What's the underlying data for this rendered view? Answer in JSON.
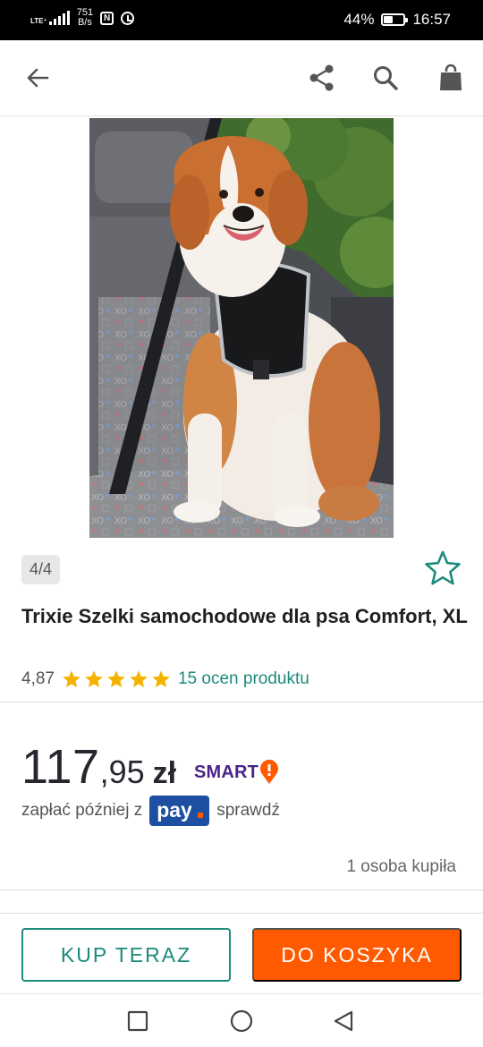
{
  "status_bar": {
    "network": "LTE⁺",
    "speed_value": "751",
    "speed_unit": "B/s",
    "nfc": "N",
    "battery": "44%",
    "battery_fill_fraction": 0.44,
    "time": "16:57"
  },
  "app_bar": {
    "icons": [
      "back-arrow-icon",
      "share-icon",
      "search-icon",
      "shopping-bag-icon"
    ]
  },
  "gallery": {
    "image_description": "dog-in-car-harness",
    "counter": "4/4"
  },
  "product": {
    "title": "Trixie Szelki samochodowe dla psa Comfort, XL",
    "rating_value": "4,87",
    "rating_stars": 5,
    "ratings_link": "15 ocen produktu"
  },
  "price": {
    "integer": "117",
    "decimal": ",95",
    "currency": "zł",
    "smart_label": "SMART"
  },
  "pay_later": {
    "prefix": "zapłać później z",
    "badge": "pay",
    "suffix": "sprawdź"
  },
  "buyers_text": "1 osoba kupiła",
  "actions": {
    "buy_now": "KUP TERAZ",
    "add_to_cart": "DO KOSZYKA"
  },
  "colors": {
    "accent_teal": "#1d8a7c",
    "cta_orange": "#ff5a00",
    "star_gold": "#f5b301",
    "smart_purple": "#4a2389",
    "pay_blue": "#1d4fa3"
  }
}
